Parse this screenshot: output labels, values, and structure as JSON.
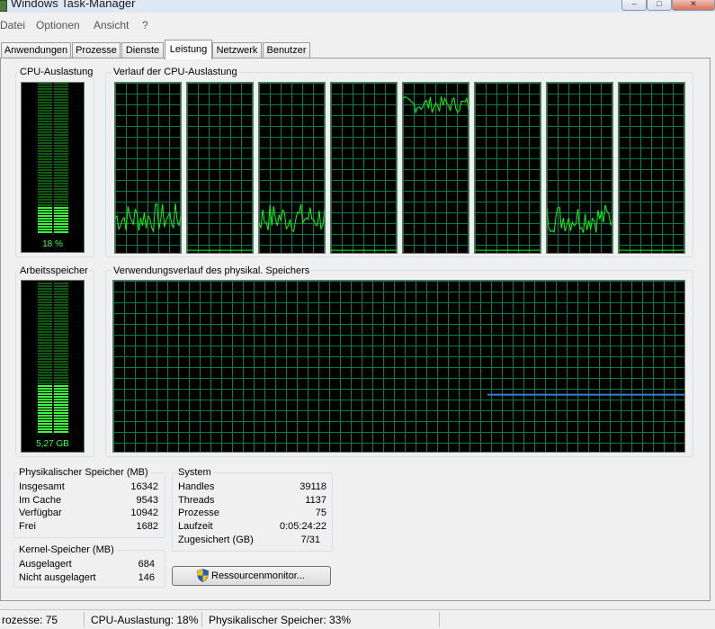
{
  "window": {
    "title": "Windows Task-Manager",
    "buttons": {
      "minimize": "–",
      "maximize": "□",
      "close": "✕"
    }
  },
  "menu": [
    "Datei",
    "Optionen",
    "Ansicht",
    "?"
  ],
  "tabs": [
    "Anwendungen",
    "Prozesse",
    "Dienste",
    "Leistung",
    "Netzwerk",
    "Benutzer"
  ],
  "active_tab": "Leistung",
  "cpu": {
    "usage_label": "CPU-Auslastung",
    "usage_value": "18 %",
    "usage_fraction": 0.18,
    "history_label": "Verlauf der CPU-Auslastung",
    "core_levels": [
      0.2,
      0,
      0.2,
      0,
      0.88,
      0,
      0.2,
      0
    ]
  },
  "memory": {
    "label": "Arbeitsspeicher",
    "value": "5,27 GB",
    "usage_fraction": 0.33,
    "history_label": "Verwendungsverlauf des physikal. Speichers"
  },
  "physical_memory": {
    "title": "Physikalischer Speicher (MB)",
    "rows": [
      {
        "label": "Insgesamt",
        "value": "16342"
      },
      {
        "label": "Im Cache",
        "value": "9543"
      },
      {
        "label": "Verfügbar",
        "value": "10942"
      },
      {
        "label": "Frei",
        "value": "1682"
      }
    ]
  },
  "kernel_memory": {
    "title": "Kernel-Speicher (MB)",
    "rows": [
      {
        "label": "Ausgelagert",
        "value": "684"
      },
      {
        "label": "Nicht ausgelagert",
        "value": "146"
      }
    ]
  },
  "system": {
    "title": "System",
    "rows": [
      {
        "label": "Handles",
        "value": "39118"
      },
      {
        "label": "Threads",
        "value": "1137"
      },
      {
        "label": "Prozesse",
        "value": "75"
      },
      {
        "label": "Laufzeit",
        "value": "0:05:24:22"
      },
      {
        "label": "Zugesichert (GB)",
        "value": "7/31"
      }
    ]
  },
  "resource_monitor_button": "Ressourcenmonitor...",
  "statusbar": {
    "processes": "rozesse: 75",
    "cpu": "CPU-Auslastung: 18%",
    "memory": "Physikalischer Speicher: 33%"
  },
  "colors": {
    "graph_bg": "#000000",
    "grid": "#008040",
    "cpu_line": "#00ff00",
    "memory_line": "#3a7bd5",
    "meter_lit": "#39ff39",
    "meter_dim": "#0e5a0e"
  },
  "icons": {
    "title_icon": "taskmanager-icon",
    "button_icon": "uac-shield-icon"
  }
}
